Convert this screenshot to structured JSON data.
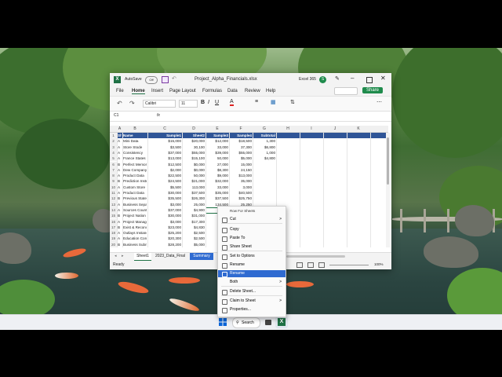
{
  "window": {
    "autosave_label": "AutoSave",
    "autosave_state": "Off",
    "filename": "Project_Alpha_Financials.xlsx",
    "app_label": "Excel 365",
    "avatar_letter": "S",
    "share_label": "Share"
  },
  "menu": {
    "tabs": [
      "File",
      "Home",
      "Insert",
      "Page Layout",
      "Formulas",
      "Data",
      "Review",
      "Help"
    ],
    "active": "Home"
  },
  "ribbon": {
    "font_name": "Calibri",
    "font_size": "11",
    "bold": "B",
    "italic": "I",
    "underline": "U",
    "font_color": "A"
  },
  "formula_bar": {
    "name_box": "C1",
    "fx": "fx",
    "value": ""
  },
  "columns": [
    "A",
    "B",
    "C",
    "D",
    "E",
    "F",
    "G",
    "H",
    "I",
    "J",
    "K"
  ],
  "table": {
    "headers": [
      "Sheet1",
      "Name",
      "Sample1",
      "Sheet2",
      "Sample3",
      "Sample4",
      "Subtotal"
    ],
    "rows": [
      [
        "A",
        "Mini Data",
        "$15,000",
        "$20,000",
        "$12,000",
        "$18,500",
        "1,300"
      ],
      [
        "A",
        "Store Stode",
        "$3,500",
        "30,100",
        "33,000",
        "37,300",
        "$6,800"
      ],
      [
        "A",
        "Consistency",
        "$37,000",
        "$55,000",
        "$39,000",
        "$55,000",
        "1,000"
      ],
      [
        "A",
        "France States",
        "$13,000",
        "$15,100",
        "50,000",
        "$5,000",
        "$4,800"
      ],
      [
        "B",
        "Perfect Memory",
        "$12,500",
        "$0,000",
        "27,000",
        "15,000",
        ""
      ],
      [
        "A",
        "Dew Company",
        "$2,000",
        "$0,000",
        "$8,300",
        "24,150",
        ""
      ],
      [
        "A",
        "Product Data",
        "$22,500",
        "50,000",
        "$9,000",
        "$13,000",
        ""
      ],
      [
        "B",
        "Prediction Instruction",
        "$24,500",
        "$21,000",
        "$32,000",
        "35,000",
        ""
      ],
      [
        "A",
        "Custom Store",
        "$5,500",
        "113,000",
        "33,000",
        "3,000",
        ""
      ],
      [
        "A",
        "Product Data",
        "$30,000",
        "$37,500",
        "$35,000",
        "$40,500",
        ""
      ],
      [
        "B",
        "Previous State",
        "$35,500",
        "$26,300",
        "$37,500",
        "$25,750",
        ""
      ],
      [
        "A",
        "Business Separation",
        "$3,000",
        "25,000",
        "134,500",
        "25,250",
        ""
      ],
      [
        "A",
        "Sources Country",
        "$37,000",
        "$4,900",
        "",
        "",
        " "
      ],
      [
        "B",
        "Project Nation",
        "$30,000",
        "$31,000",
        "",
        "",
        ""
      ],
      [
        "A",
        "Project Management",
        "$3,000",
        "$17,300",
        "",
        "",
        ""
      ],
      [
        "B",
        "Exist & Reconciliation",
        "$23,000",
        "$4,830",
        "",
        "",
        ""
      ],
      [
        "A",
        "Outlays Instance",
        "$25,200",
        "$2,500",
        "",
        "",
        ""
      ],
      [
        "A",
        "Education Contamination",
        "$20,300",
        "$2,500",
        "",
        "",
        ""
      ],
      [
        "B",
        "Business Submarines",
        "$28,200",
        "$5,000",
        "",
        "",
        ""
      ],
      [
        "A",
        "Partial Permission",
        "",
        "",
        "",
        "",
        ""
      ]
    ],
    "row_numbers": [
      "1",
      "2",
      "3",
      "4",
      "5",
      "6",
      "7",
      "8",
      "9",
      "10",
      "11",
      "12",
      "13",
      "14",
      "15",
      "16",
      "17",
      "18",
      "19",
      "20",
      "21"
    ]
  },
  "sheet_tabs": [
    "Sheet1",
    "2023_Data_Final",
    "Summary"
  ],
  "active_sheet": "Summary",
  "status": {
    "ready": "Ready",
    "zoom": "100%"
  },
  "context_menu": {
    "header": "Row For Sheets",
    "items": [
      {
        "label": "Cut",
        "icon": "scissors-icon",
        "arrow": ">"
      },
      {
        "label": "Copy",
        "icon": "copy-icon",
        "arrow": ""
      },
      {
        "label": "Paste To",
        "icon": "paste-icon",
        "arrow": ""
      },
      {
        "label": "Share Sheet",
        "icon": "share-icon",
        "arrow": ""
      },
      {
        "label": "Set to Options",
        "icon": "options-icon",
        "arrow": ""
      },
      {
        "label": "Rename",
        "icon": "rename-icon",
        "arrow": ""
      },
      {
        "label": "Rename",
        "icon": "rename-icon",
        "arrow": ""
      },
      {
        "label": "Both",
        "icon": "",
        "arrow": ">"
      },
      {
        "label": "Delete Sheet...",
        "icon": "delete-icon",
        "arrow": ""
      },
      {
        "label": "Claim to Sheet",
        "icon": "claim-icon",
        "arrow": ">"
      },
      {
        "label": "Properties...",
        "icon": "properties-icon",
        "arrow": ""
      }
    ],
    "highlighted_index": 6
  },
  "taskbar": {
    "search_label": "Search"
  },
  "colors": {
    "excel_green": "#1e7145",
    "header_blue": "#2f5597",
    "highlight": "#2f6bd1",
    "share_green": "#1f8b4c"
  }
}
